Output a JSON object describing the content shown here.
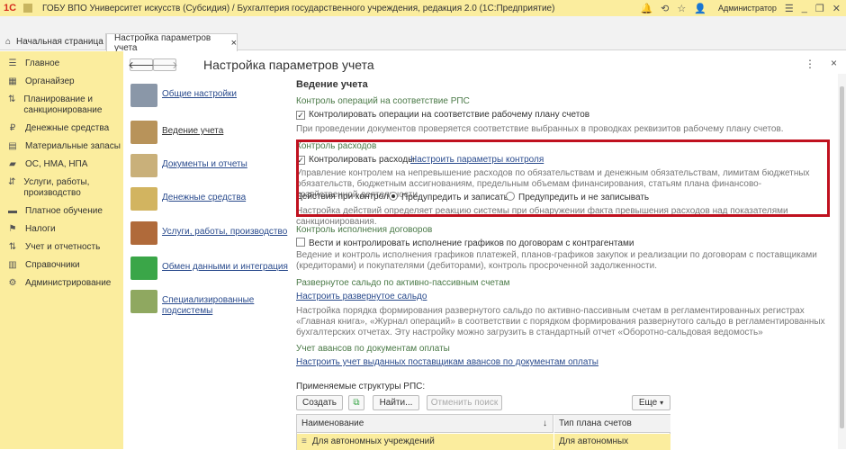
{
  "titlebar": {
    "logo": "1С",
    "title": "ГОБУ ВПО Университет искусств (Субсидия) / Бухгалтерия государственного учреждения, редакция 2.0   (1С:Предприятие)",
    "user": "Администратор"
  },
  "tabs": [
    {
      "label": "Начальная страница"
    },
    {
      "label": "Настройка параметров учета",
      "close": "×"
    }
  ],
  "sidebar": {
    "items": [
      {
        "label": "Главное",
        "icon": "menu-icon"
      },
      {
        "label": "Органайзер",
        "icon": "organizer-icon"
      },
      {
        "label": "Планирование и санкционирование",
        "icon": "planning-icon"
      },
      {
        "label": "Денежные средства",
        "icon": "money-icon"
      },
      {
        "label": "Материальные запасы",
        "icon": "inventory-icon"
      },
      {
        "label": "ОС, НМА, НПА",
        "icon": "assets-icon"
      },
      {
        "label": "Услуги, работы, производство",
        "icon": "services-icon"
      },
      {
        "label": "Платное обучение",
        "icon": "education-icon"
      },
      {
        "label": "Налоги",
        "icon": "taxes-icon"
      },
      {
        "label": "Учет и отчетность",
        "icon": "reports-icon"
      },
      {
        "label": "Справочники",
        "icon": "catalogs-icon"
      },
      {
        "label": "Администрирование",
        "icon": "gear-icon"
      }
    ]
  },
  "header": {
    "title": "Настройка параметров учета",
    "back": "🡐",
    "forward": "🡒",
    "more": "⋮",
    "close": "×"
  },
  "nav": [
    {
      "label": "Общие настройки",
      "color": "#8a97a8"
    },
    {
      "label": "Ведение учета",
      "color": "#b8935a"
    },
    {
      "label": "Документы и отчеты",
      "color": "#c9b07a"
    },
    {
      "label": "Денежные средства",
      "color": "#d2b460"
    },
    {
      "label": "Услуги, работы, производство",
      "color": "#b06a3a"
    },
    {
      "label": "Обмен данными и интеграция",
      "color": "#3aa648"
    },
    {
      "label": "Специализированные подсистемы",
      "color": "#8fa860"
    }
  ],
  "content": {
    "section_title": "Ведение учета",
    "rps": {
      "title": "Контроль операций на соответствие РПС",
      "checkbox": "Контролировать операции на соответствие рабочему плану счетов",
      "checked": true,
      "hint": "При проведении документов проверяется соответствие выбранных в проводках реквизитов рабочему плану счетов."
    },
    "expenses": {
      "title": "Контроль расходов",
      "checkbox": "Контролировать расходы",
      "checked": true,
      "link": "Настроить параметры контроля",
      "hint": "Управление контролем на непревышение расходов по обязательствам и денежным обязательствам, лимитам бюджетных обязательств, бюджетным ассигнованиям, предельным объемам финансирования, статьям плана финансово-хозяйственной деятельности.",
      "actions_label": "Действия при контроле:",
      "radio1": "Предупредить и записать",
      "radio2": "Предупредить и не записывать",
      "radio_selected": 1,
      "hint2": "Настройка действий определяет реакцию системы при обнаружении факта превышения расходов над показателями санкционирования."
    },
    "contracts": {
      "title": "Контроль исполнения договоров",
      "checkbox": "Вести и контролировать исполнение графиков по договорам с контрагентами",
      "checked": false,
      "hint": "Ведение и контроль исполнения графиков платежей, планов-графиков закупок и реализации по договорам с поставщиками (кредиторами) и покупателями (дебиторами), контроль просроченной задолженности."
    },
    "balance": {
      "title": "Развернутое сальдо по активно-пассивным счетам",
      "link": "Настроить развернутое сальдо",
      "hint": "Настройка порядка формирования развернутого сальдо по активно-пассивным счетам в регламентированных регистрах «Главная книга», «Журнал операций» в соответствии с порядком формирования развернутого сальдо в регламентированных бухгалтерских отчетах. Эту настройку можно загрузить в стандартный отчет «Оборотно-сальдовая ведомость»"
    },
    "advances": {
      "title": "Учет авансов по документам оплаты",
      "link": "Настроить учет выданных поставщикам авансов по документам оплаты"
    },
    "structures": {
      "label": "Применяемые структуры РПС:",
      "btn_create": "Создать",
      "btn_find": "Найти...",
      "btn_cancel": "Отменить поиск",
      "btn_more": "Еще",
      "col1": "Наименование",
      "col2": "Тип плана счетов",
      "sort": "↓",
      "row_name": "Для автономных учреждений",
      "row_type": "Для автономных"
    }
  }
}
